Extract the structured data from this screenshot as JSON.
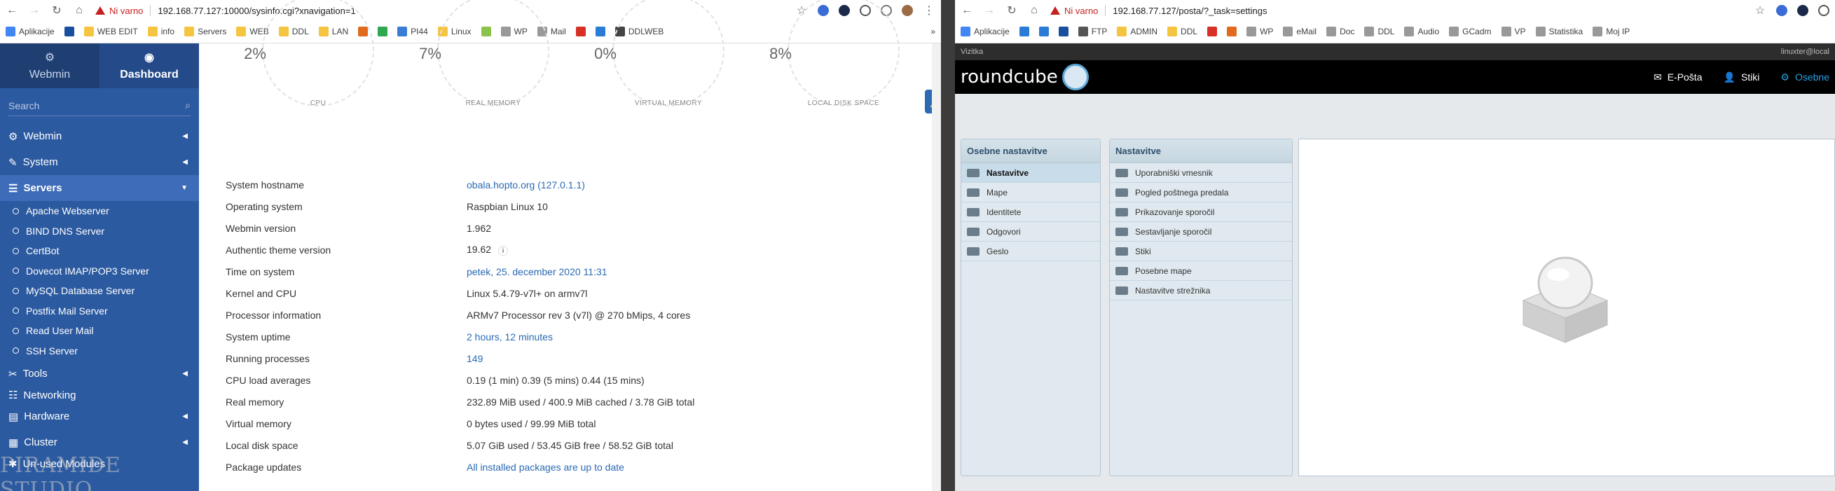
{
  "left_browser": {
    "warning": "Ni varno",
    "url": "192.168.77.127:10000/sysinfo.cgi?xnavigation=1",
    "bookmarks": [
      "Aplikacije",
      "WEB EDIT",
      "info",
      "Servers",
      "WEB",
      "DDL",
      "LAN",
      "PI44",
      "Linux",
      "WP",
      "Mail",
      "DDLWEB"
    ]
  },
  "webmin": {
    "tab_webmin": "Webmin",
    "tab_dashboard": "Dashboard",
    "search_placeholder": "Search",
    "menu": [
      {
        "label": "Webmin"
      },
      {
        "label": "System"
      },
      {
        "label": "Servers"
      },
      {
        "label": "Tools"
      },
      {
        "label": "Networking"
      },
      {
        "label": "Hardware"
      },
      {
        "label": "Cluster"
      },
      {
        "label": "Un-used Modules"
      }
    ],
    "servers_sub": [
      "Apache Webserver",
      "BIND DNS Server",
      "CertBot",
      "Dovecot IMAP/POP3 Server",
      "MySQL Database Server",
      "Postfix Mail Server",
      "Read User Mail",
      "SSH Server"
    ],
    "watermark": "PIRAMIDE STUDIO",
    "gauges": [
      {
        "value": "2%",
        "label": "CPU"
      },
      {
        "value": "7%",
        "label": "REAL MEMORY"
      },
      {
        "value": "0%",
        "label": "VIRTUAL MEMORY"
      },
      {
        "value": "8%",
        "label": "LOCAL DISK SPACE"
      }
    ],
    "info": [
      {
        "k": "System hostname",
        "v": "obala.hopto.org (127.0.1.1)"
      },
      {
        "k": "Operating system",
        "v": "Raspbian Linux 10"
      },
      {
        "k": "Webmin version",
        "v": "1.962"
      },
      {
        "k": "Authentic theme version",
        "v": "19.62"
      },
      {
        "k": "Time on system",
        "v": "petek, 25. december 2020 11:31"
      },
      {
        "k": "Kernel and CPU",
        "v": "Linux 5.4.79-v7l+ on armv7l"
      },
      {
        "k": "Processor information",
        "v": "ARMv7 Processor rev 3 (v7l) @ 270 bMips, 4 cores"
      },
      {
        "k": "System uptime",
        "v": "2 hours, 12 minutes"
      },
      {
        "k": "Running processes",
        "v": "149"
      },
      {
        "k": "CPU load averages",
        "v": "0.19 (1 min) 0.39 (5 mins) 0.44 (15 mins)"
      },
      {
        "k": "Real memory",
        "v": "232.89 MiB used / 400.9 MiB cached / 3.78 GiB total"
      },
      {
        "k": "Virtual memory",
        "v": "0 bytes used / 99.99 MiB total"
      },
      {
        "k": "Local disk space",
        "v": "5.07 GiB used / 53.45 GiB free / 58.52 GiB total"
      },
      {
        "k": "Package updates",
        "v": "All installed packages are up to date"
      }
    ]
  },
  "right_browser": {
    "warning": "Ni varno",
    "url": "192.168.77.127/posta/?_task=settings",
    "bookmarks": [
      "Aplikacije",
      "FTP",
      "ADMIN",
      "DDL",
      "WP",
      "eMail",
      "Doc",
      "DDL",
      "Audio",
      "GCadm",
      "VP",
      "Statistika",
      "Moj IP"
    ]
  },
  "roundcube": {
    "vizitka": "Vizitka",
    "user": "linuxter@local",
    "logo": "roundcube",
    "nav": [
      "E-Pošta",
      "Stiki",
      "Osebne"
    ],
    "panel1_title": "Osebne nastavitve",
    "panel1_items": [
      "Nastavitve",
      "Mape",
      "Identitete",
      "Odgovori",
      "Geslo"
    ],
    "panel2_title": "Nastavitve",
    "panel2_items": [
      "Uporabniški vmesnik",
      "Pogled poštnega predala",
      "Prikazovanje sporočil",
      "Sestavljanje sporočil",
      "Stiki",
      "Posebne mape",
      "Nastavitve strežnika"
    ]
  }
}
